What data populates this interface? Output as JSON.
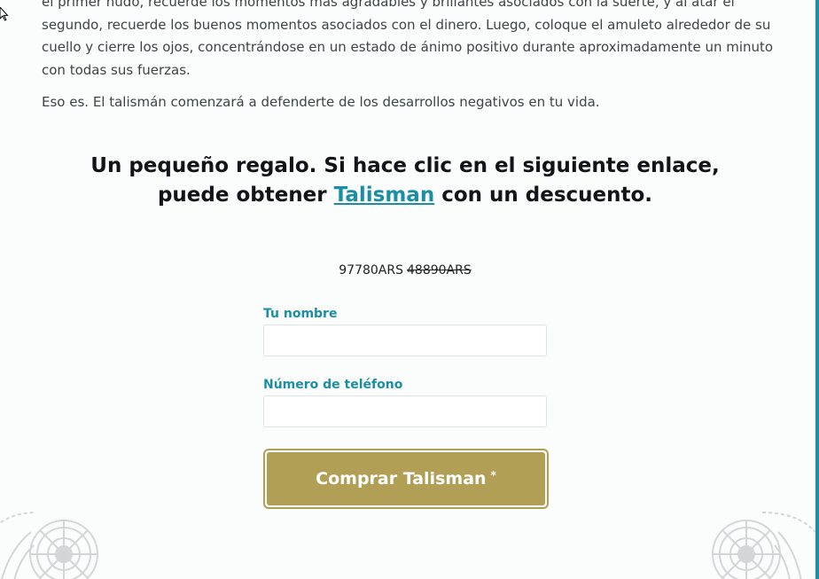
{
  "article": {
    "paragraph_1": "el primer nudo, recuerde los momentos más agradables y brillantes asociados con la suerte, y al atar el segundo, recuerde los buenos momentos asociados con el dinero. Luego, coloque el amuleto alrededor de su cuello y cierre los ojos, concentrándose en un estado de ánimo positivo durante aproximadamente un minuto con todas sus fuerzas.",
    "paragraph_2": "Eso es. El talismán comenzará a defenderte de los desarrollos negativos en tu vida."
  },
  "offer": {
    "heading_before": "Un pequeño regalo. Si hace clic en el siguiente enlace, puede obtener ",
    "heading_link": "Talisman",
    "heading_after": " con un descuento.",
    "new_price": "97780ARS",
    "old_price": "48890ARS"
  },
  "form": {
    "name_label": "Tu nombre",
    "name_value": "",
    "phone_label": "Número de teléfono",
    "phone_value": "",
    "submit_label": "Comprar Talisman",
    "submit_mark": "*"
  },
  "colors": {
    "accent": "#1c8ea3",
    "button": "#b19f55",
    "heading": "#111418",
    "body_text": "#3e4446"
  },
  "icons": {
    "cursor": "arrow-cursor-icon",
    "ornament": "mandala-ornament-icon"
  }
}
